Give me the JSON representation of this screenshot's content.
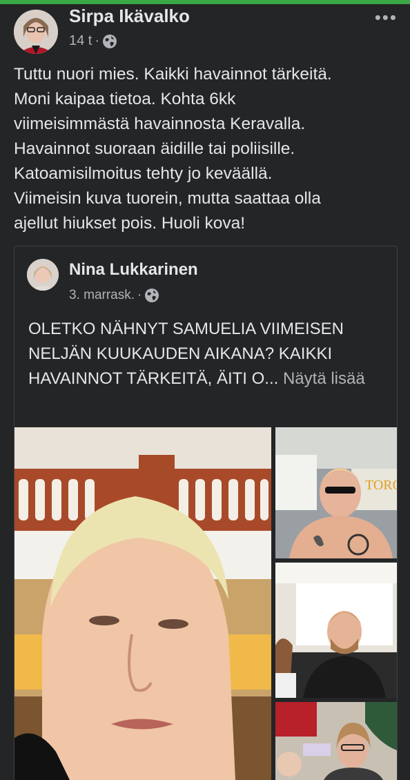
{
  "post": {
    "author": "Sirpa Ikävalko",
    "time": "14 t",
    "separator": "·",
    "more_label": "•••",
    "text": "Tuttu nuori mies. Kaikki havainnot tärkeitä.\nMoni kaipaa tietoa. Kohta 6kk\nviimeisimmästä havainnosta Keravalla.\nHavainnot suoraan äidille tai poliisille.\nKatoamisilmoitus tehty jo keväällä.\nViimeisin kuva tuorein, mutta saattaa olla\najellut hiukset pois. Huoli kova!"
  },
  "shared_post": {
    "author": "Nina Lukkarinen",
    "date": "3. marrask.",
    "separator": "·",
    "text": "OLETKO NÄHNYT SAMUELIA VIIMEISEN NELJÄN KUUKAUDEN AIKANA? KAIKKI HAVAINNOT TÄRKEITÄ, ÄITI O...",
    "see_more": "Näytä lisää"
  },
  "colors": {
    "background": "#242526",
    "text_primary": "#e4e6eb",
    "text_secondary": "#b0b3b8",
    "accent_bar": "#3aa845"
  },
  "icons": {
    "privacy": "globe-icon",
    "menu": "more-options-icon"
  }
}
